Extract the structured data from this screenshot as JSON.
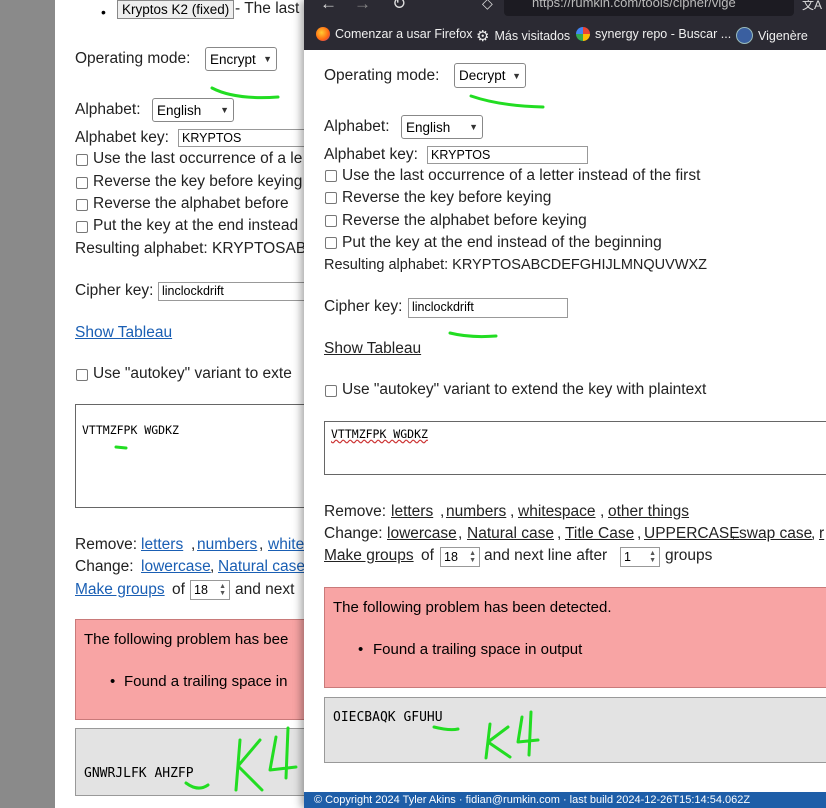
{
  "background_page": {
    "bullet_tag": "Kryptos K2 (fixed)",
    "bullet_text": " - The last",
    "operating_mode_label": "Operating mode:",
    "operating_mode_value": "Encrypt",
    "alphabet_label": "Alphabet:",
    "alphabet_value": "English",
    "alphabet_key_label": "Alphabet key:",
    "alphabet_key_value": "KRYPTOS",
    "opt_last_occurrence": "Use the last occurrence of a le",
    "opt_reverse_key": "Reverse the key before keying",
    "opt_reverse_alphabet": "Reverse the alphabet before",
    "opt_key_end": "Put the key at the end instead",
    "resulting_alphabet": "Resulting alphabet: KRYPTOSAB",
    "cipher_key_label": "Cipher key:",
    "cipher_key_value": "linclockdrift",
    "show_tableau": "Show Tableau",
    "autokey_label": "Use \"autokey\" variant to exte",
    "input_text": "VTTMZFPK WGDKZ",
    "remove_label": "Remove:",
    "remove_letters": "letters",
    "remove_numbers": "numbers",
    "remove_whitespace_partial": "white",
    "change_label": "Change:",
    "change_lowercase": "lowercase",
    "change_natural_partial": "Natural case",
    "make_groups": "Make groups",
    "of_label": "of",
    "group_size": "18",
    "and_next_partial": "and next",
    "problem_heading": "The following problem has bee",
    "problem_item": "Found a trailing space in",
    "output_text": "GNWRJLFK AHZFP",
    "handwritten_note": "K4"
  },
  "foreground_window": {
    "url_partial": "https://rumkin.com/tools/cipher/vige",
    "bookmarks": [
      {
        "label": "Comenzar a usar Firefox",
        "icon": "firefox-icon"
      },
      {
        "label": "Más visitados",
        "icon": "gear-icon"
      },
      {
        "label": "synergy repo - Buscar ...",
        "icon": "google-icon"
      },
      {
        "label": "Vigenère",
        "icon": "vigenere-icon"
      }
    ],
    "operating_mode_label": "Operating mode:",
    "operating_mode_value": "Decrypt",
    "alphabet_label": "Alphabet:",
    "alphabet_value": "English",
    "alphabet_key_label": "Alphabet key:",
    "alphabet_key_value": "KRYPTOS",
    "opt_last_occurrence": "Use the last occurrence of a letter instead of the first",
    "opt_reverse_key": "Reverse the key before keying",
    "opt_reverse_alphabet": "Reverse the alphabet before keying",
    "opt_key_end": "Put the key at the end instead of the beginning",
    "resulting_alphabet": "Resulting alphabet: KRYPTOSABCDEFGHIJLMNQUVWXZ",
    "cipher_key_label": "Cipher key:",
    "cipher_key_value": "linclockdrift",
    "show_tableau": "Show Tableau",
    "autokey_label": "Use \"autokey\" variant to extend the key with plaintext",
    "input_text": "VTTMZFPK WGDKZ",
    "remove_label": "Remove:",
    "remove_letters": "letters",
    "remove_numbers": "numbers",
    "remove_whitespace": "whitespace",
    "remove_other": "other things",
    "change_label": "Change:",
    "change_lowercase": "lowercase",
    "change_natural": "Natural case",
    "change_title": "Title Case",
    "change_upper": "UPPERCASE",
    "change_swap": "swap case",
    "change_partial": "r",
    "make_groups": "Make groups",
    "of_label": "of",
    "group_size": "18",
    "next_line_label": "and next line after",
    "next_line_value": "1",
    "groups_label": "groups",
    "problem_heading": "The following problem has been detected.",
    "problem_item": "Found a trailing space in output",
    "output_text": "OIECBAQK GFUHU",
    "handwritten_note": "K4",
    "footer_text": "© Copyright 2024 Tyler Akins · fidian@rumkin.com · last build 2024-12-26T15:14:54.062Z"
  },
  "colors": {
    "annotation_green": "#22dd22",
    "link_blue": "#1a5fb4",
    "error_bg": "#f8a4a4",
    "output_bg": "#e3e3e3",
    "browser_chrome": "#2b2a33",
    "footer_blue": "#1e5ea8"
  }
}
